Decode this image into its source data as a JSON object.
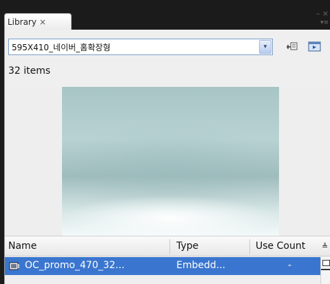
{
  "panel": {
    "tab_label": "Library",
    "tab_close": "×",
    "window_minimize": "–",
    "window_close": "×",
    "panel_menu": "▾≡"
  },
  "library": {
    "selected_document": "595X410_네이버_홈확장형",
    "dropdown_arrow": "▾",
    "item_count": "32 items"
  },
  "columns": {
    "name": "Name",
    "type": "Type",
    "use_count": "Use Count",
    "sort_toggle": "≜"
  },
  "rows": [
    {
      "name": "OC_promo_470_32...",
      "type": "Embedd...",
      "use_count": "-"
    }
  ],
  "colors": {
    "selection": "#3a76cf",
    "accent_border": "#7a9cc6"
  }
}
